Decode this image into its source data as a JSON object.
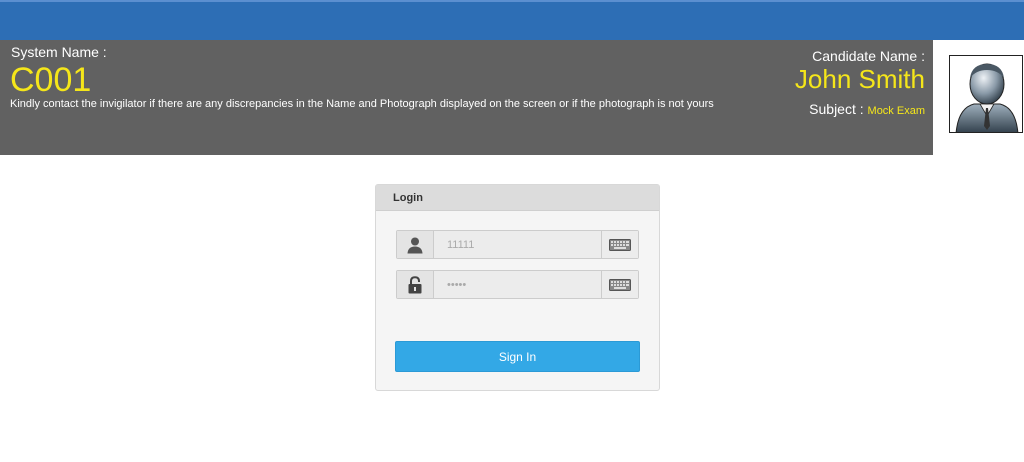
{
  "header": {
    "system_name_label": "System Name :",
    "system_name_value": "C001",
    "notice": "Kindly contact the invigilator if there are any discrepancies in the Name and Photograph displayed on the screen or if the photograph is not yours",
    "candidate_name_label": "Candidate Name :",
    "candidate_name_value": "John Smith",
    "subject_label": "Subject : ",
    "subject_value": "Mock Exam",
    "photo_icon": "user-avatar-icon"
  },
  "login": {
    "title": "Login",
    "username_placeholder": "11111",
    "username_icon": "user-icon",
    "password_placeholder": "•••••",
    "password_icon": "lock-icon",
    "keyboard_icon": "keyboard-icon",
    "sign_in_label": "Sign In"
  },
  "colors": {
    "topbar": "#2d6eb5",
    "header_bg": "#616161",
    "highlight": "#f5e61a",
    "button": "#33a8e6"
  }
}
